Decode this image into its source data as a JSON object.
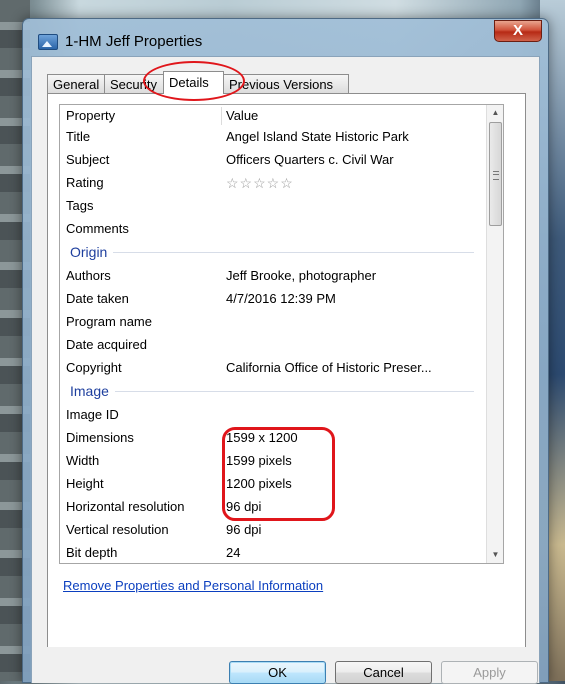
{
  "window": {
    "title": "1-HM Jeff Properties",
    "close_label": "X"
  },
  "tabs": [
    {
      "label": "General"
    },
    {
      "label": "Security"
    },
    {
      "label": "Details"
    },
    {
      "label": "Previous Versions"
    }
  ],
  "active_tab": "Details",
  "details": {
    "header": {
      "property": "Property",
      "value": "Value"
    },
    "rows_top": [
      {
        "property": "Title",
        "value": "Angel Island State Historic Park"
      },
      {
        "property": "Subject",
        "value": "Officers Quarters c. Civil War"
      },
      {
        "property": "Rating",
        "value": "☆☆☆☆☆"
      },
      {
        "property": "Tags",
        "value": ""
      },
      {
        "property": "Comments",
        "value": ""
      }
    ],
    "group_origin": "Origin",
    "rows_origin": [
      {
        "property": "Authors",
        "value": "Jeff Brooke, photographer"
      },
      {
        "property": "Date taken",
        "value": "4/7/2016 12:39 PM"
      },
      {
        "property": "Program name",
        "value": ""
      },
      {
        "property": "Date acquired",
        "value": ""
      },
      {
        "property": "Copyright",
        "value": "California Office of Historic Preser..."
      }
    ],
    "group_image": "Image",
    "rows_image": [
      {
        "property": "Image ID",
        "value": ""
      },
      {
        "property": "Dimensions",
        "value": "1599 x 1200"
      },
      {
        "property": "Width",
        "value": "1599 pixels"
      },
      {
        "property": "Height",
        "value": "1200 pixels"
      },
      {
        "property": "Horizontal resolution",
        "value": "96 dpi"
      },
      {
        "property": "Vertical resolution",
        "value": "96 dpi"
      },
      {
        "property": "Bit depth",
        "value": "24"
      }
    ]
  },
  "remove_link": "Remove Properties and Personal Information",
  "buttons": {
    "ok": "OK",
    "cancel": "Cancel",
    "apply": "Apply"
  },
  "colors": {
    "highlight": "#e0161b",
    "link": "#0b3fbf",
    "group_heading": "#1e3f9e"
  }
}
